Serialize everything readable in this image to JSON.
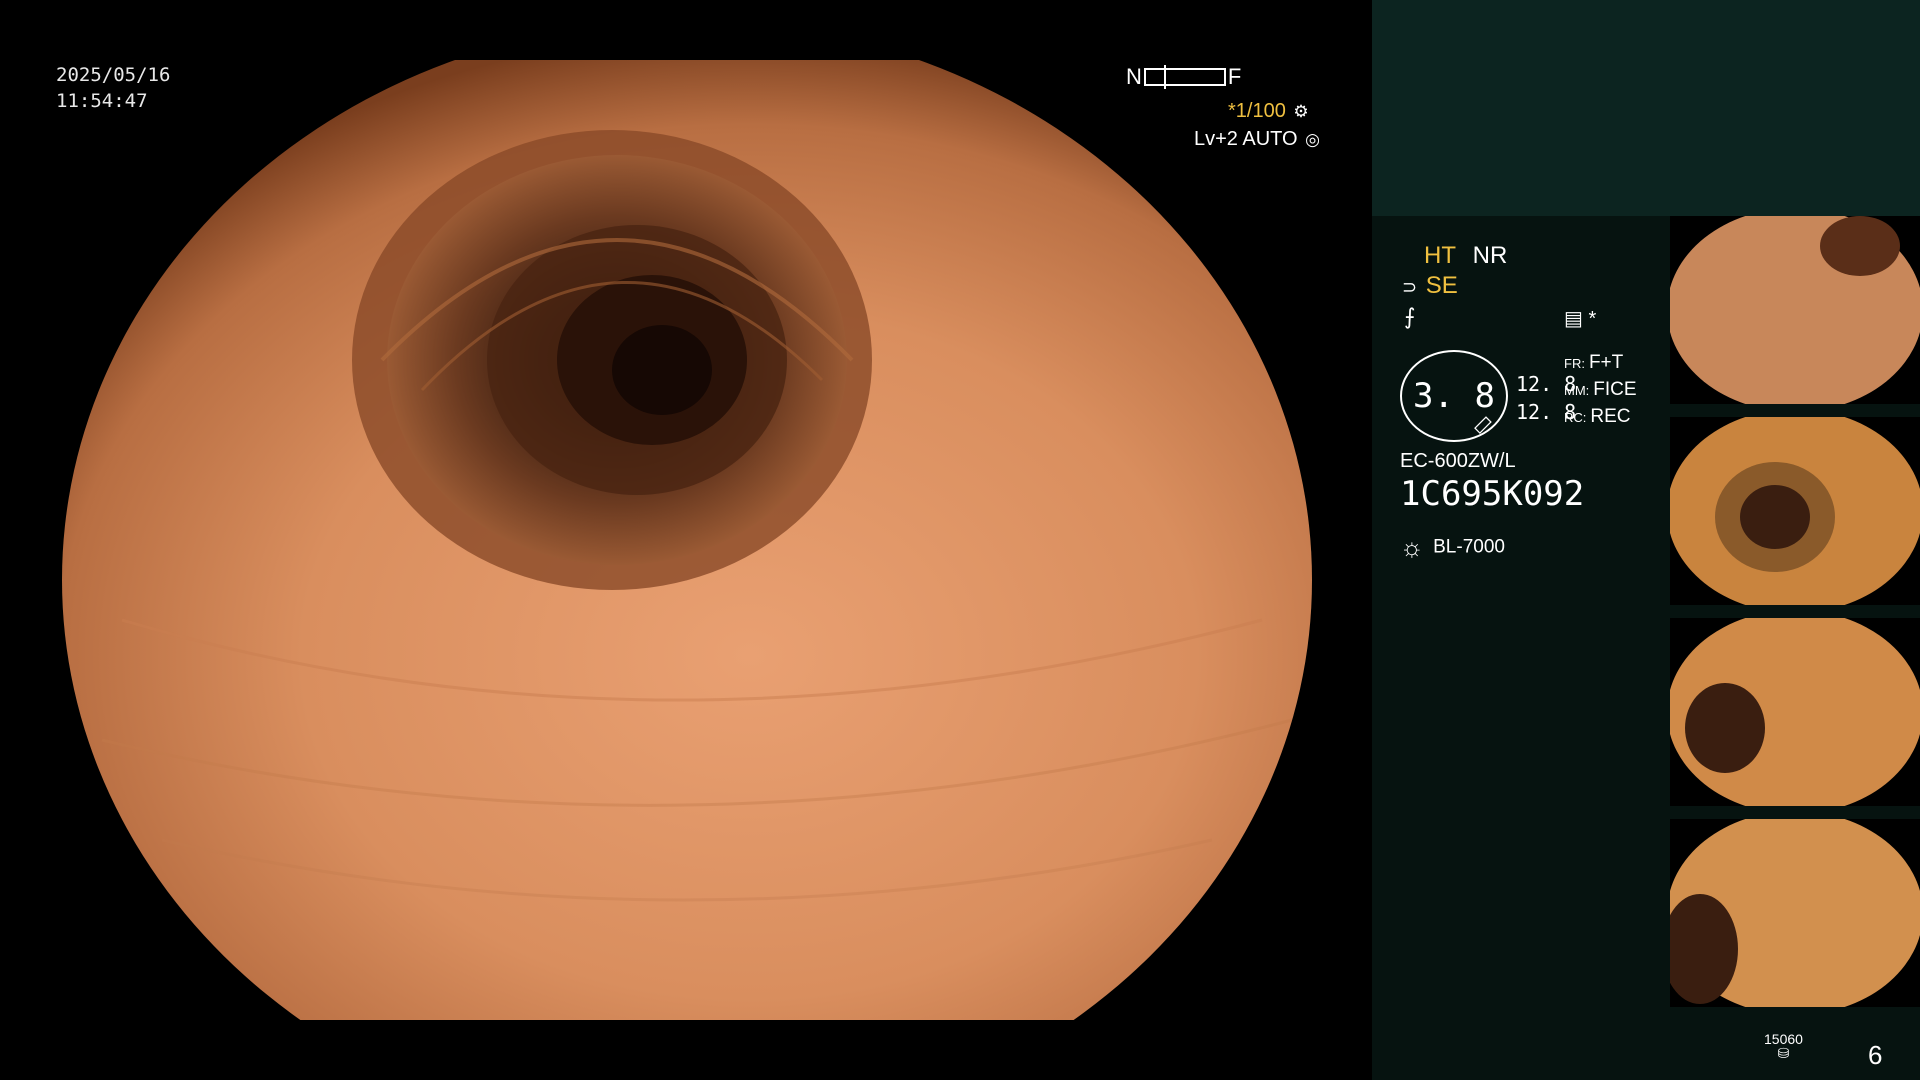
{
  "overlay": {
    "date": "2025/05/16",
    "time": "11:54:47",
    "near_label": "N",
    "far_label": "F",
    "shutter": "*1/100",
    "level": "Lv+2",
    "iris": "AUTO"
  },
  "panel": {
    "ht": "HT",
    "nr": "NR",
    "se": "SE",
    "asterisk": "*",
    "dial_value": "3. 8",
    "value1": "12. 8",
    "value2": "12. 8",
    "fr_key": "FR:",
    "fr_val": "F+T",
    "mm_key": "MM:",
    "mm_val": "FICE",
    "rc_key": "RC:",
    "rc_val": "REC",
    "scope_model": "EC-600ZW/L",
    "serial": "1C695K092",
    "light_source": "BL-7000",
    "image_counter": "15060",
    "page_number": "6"
  },
  "icons": [
    "gear-icon",
    "iris-icon",
    "edge-enhance-icon",
    "structure-icon",
    "light-source-icon",
    "disk-icon"
  ],
  "thumbnails": [
    {
      "label": "captured-image-1"
    },
    {
      "label": "captured-image-2"
    },
    {
      "label": "captured-image-3"
    },
    {
      "label": "captured-image-4"
    }
  ]
}
